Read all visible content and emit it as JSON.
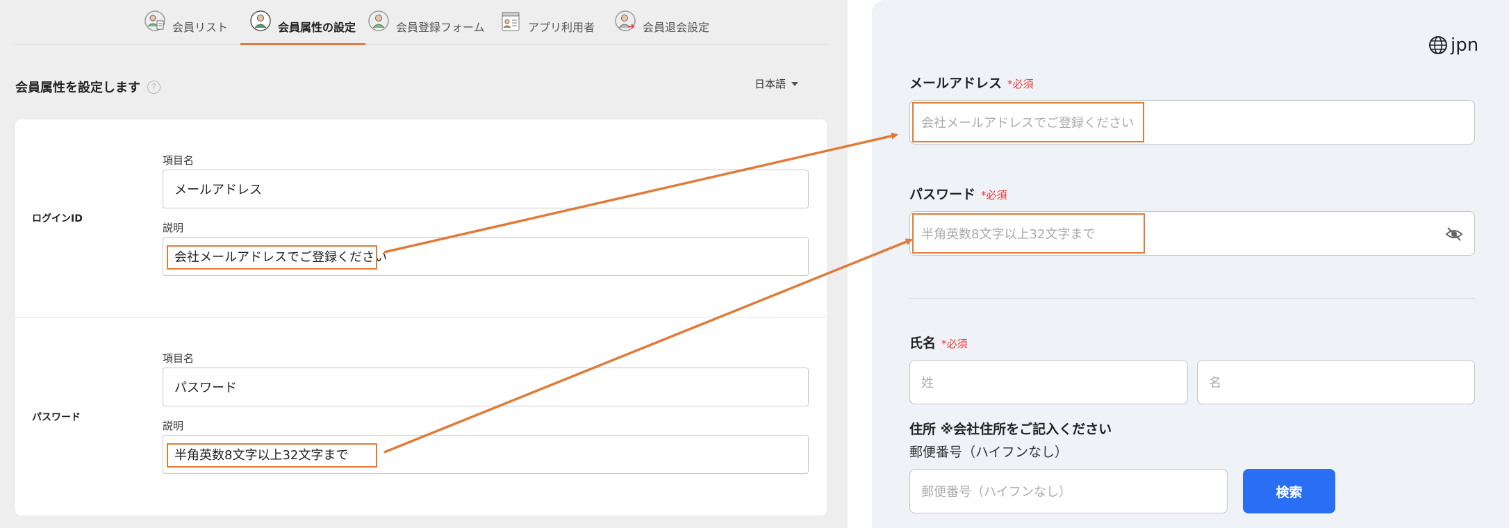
{
  "tabs": [
    {
      "label": "会員リスト",
      "icon": "member-list-icon"
    },
    {
      "label": "会員属性の設定",
      "icon": "member-attribute-icon",
      "active": true
    },
    {
      "label": "会員登録フォーム",
      "icon": "registration-form-icon"
    },
    {
      "label": "アプリ利用者",
      "icon": "app-user-icon"
    },
    {
      "label": "会員退会設定",
      "icon": "withdrawal-icon"
    }
  ],
  "page_title": "会員属性を設定します",
  "help_icon_glyph": "?",
  "language": "日本語",
  "rows": [
    {
      "row_label": "ログインID",
      "name_label": "項目名",
      "name_value": "メールアドレス",
      "desc_label": "説明",
      "desc_value": "会社メールアドレスでご登録ください"
    },
    {
      "row_label": "パスワード",
      "name_label": "項目名",
      "name_value": "パスワード",
      "desc_label": "説明",
      "desc_value": "半角英数8文字以上32文字まで"
    }
  ],
  "preview": {
    "lang_code": "jpn",
    "required": "*必須",
    "email_label": "メールアドレス",
    "email_placeholder": "会社メールアドレスでご登録ください",
    "password_label": "パスワード",
    "password_placeholder": "半角英数8文字以上32文字まで",
    "name_label": "氏名",
    "last_name_placeholder": "姓",
    "first_name_placeholder": "名",
    "address_label": "住所 ※会社住所をご記入ください",
    "postal_label": "郵便番号（ハイフンなし）",
    "postal_placeholder": "郵便番号（ハイフンなし）",
    "search_button": "検索"
  },
  "colors": {
    "accent": "#e07b39",
    "required": "#e53935",
    "button": "#2a6ef4"
  }
}
